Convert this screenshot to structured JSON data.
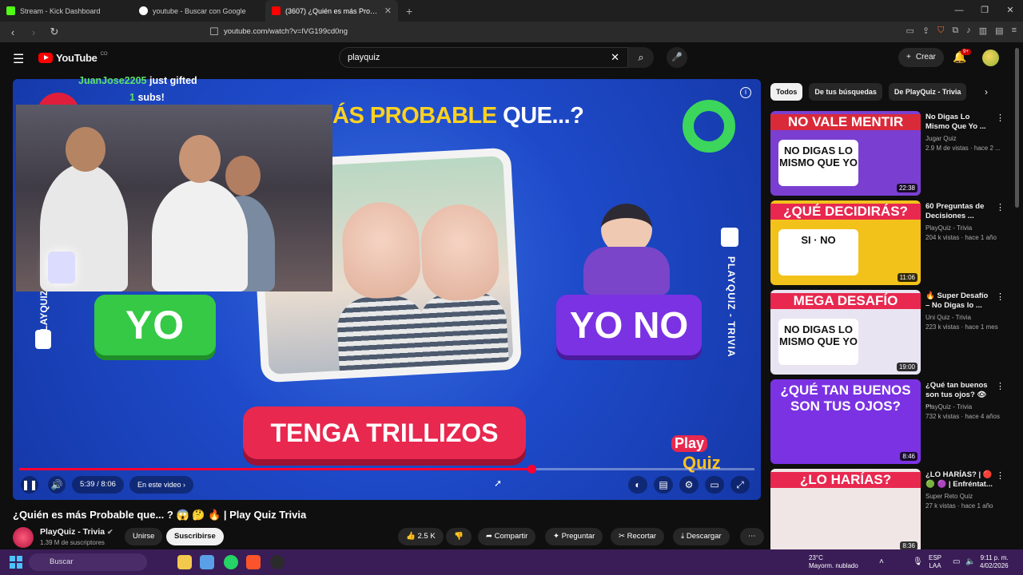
{
  "browser": {
    "tabs": [
      {
        "label": "Stream - Kick Dashboard",
        "color": "#53fc18"
      },
      {
        "label": "youtube - Buscar con Google",
        "color": "#ffffff"
      },
      {
        "label": "(3607) ¿Quién es más Probab...",
        "color": "#ff0000"
      }
    ],
    "url": "youtube.com/watch?v=lVG199cd0ng"
  },
  "yt": {
    "logo": "YouTube",
    "logo_suffix": "CO",
    "search_value": "playquiz",
    "create_label": "Crear",
    "notif_badge": "9+"
  },
  "overlay": {
    "gift_user": "JuanJose2205",
    "gift_text": "just gifted",
    "gift_count": "1",
    "gift_unit": "subs!"
  },
  "video": {
    "headline_yellow": "ÁS PROBABLE",
    "headline_white": "QUE...?",
    "yo": "YO",
    "yono": "YO NO",
    "prompt": "TENGA TRILLIZOS",
    "side_text": "PLAYQUIZ - TRIVIA",
    "side_text_left": "PLAYQUIZ",
    "logo_top": "Play",
    "logo_bottom": "Quiz",
    "time": "5:39 / 8:06",
    "chapter": "En este video",
    "progress": 0.697
  },
  "meta": {
    "title": "¿Quién es más Probable que... ? 😱 🤔 🔥 | Play Quiz Trivia",
    "channel": "PlayQuiz - Trivia",
    "subs": "1.39 M de suscriptores",
    "join": "Unirse",
    "subscribe": "Suscribirse",
    "likes": "2.5 K",
    "share": "Compartir",
    "ask": "Preguntar",
    "clip": "Recortar",
    "download": "Descargar"
  },
  "chips": [
    "Todos",
    "De tus búsquedas",
    "De PlayQuiz - Trivia"
  ],
  "recs": [
    {
      "title": "No Digas Lo Mismo Que Yo ...",
      "channel": "Jugar Quiz",
      "meta": "2.9 M de vistas · hace 2 ...",
      "duration": "22:38",
      "thumb_top": "NO VALE MENTIR",
      "thumb_box": "NO DIGAS LO MISMO QUE YO",
      "bg": "#7a3fd1",
      "top_bg": "#d92a3a"
    },
    {
      "title": "60 Preguntas de Decisiones ...",
      "channel": "PlayQuiz - Trivia",
      "meta": "204 k vistas · hace 1 año",
      "duration": "11:06",
      "thumb_top": "¿QUÉ DECIDIRÁS?",
      "thumb_box": "SI · NO",
      "bg": "#f2c21b",
      "top_bg": "#e8284f"
    },
    {
      "title": "🔥 Super Desafío – No Digas lo ...",
      "channel": "Uni Quiz - Trivia",
      "meta": "223 k vistas · hace 1 mes",
      "duration": "19:00",
      "thumb_top": "MEGA DESAFÍO",
      "thumb_box": "NO DIGAS LO MISMO QUE YO",
      "bg": "#e9e4f2",
      "top_bg": "#e8284f"
    },
    {
      "title": "¿Qué tan buenos son tus ojos? 👁 ...",
      "channel": "PlayQuiz - Trivia",
      "meta": "732 k vistas · hace 4 años",
      "duration": "8:46",
      "thumb_top": "¿QUÉ TAN BUENOS SON TUS OJOS?",
      "thumb_box": "",
      "bg": "#7b32e3",
      "top_bg": "#7b32e3"
    },
    {
      "title": "¿LO HARÍAS? | 🔴 🟢 🟣 | Enfréntat...",
      "channel": "Super Reto Quiz",
      "meta": "27 k vistas · hace 1 año",
      "duration": "8:36",
      "thumb_top": "¿LO HARÍAS?",
      "thumb_box": "",
      "bg": "#f0e6e6",
      "top_bg": "#e8284f"
    }
  ],
  "taskbar": {
    "search": "Buscar",
    "temp": "23°C",
    "weather": "Mayorm. nublado",
    "lang1": "ESP",
    "lang2": "LAA",
    "time": "9:11 p. m.",
    "date": "4/02/2026"
  }
}
